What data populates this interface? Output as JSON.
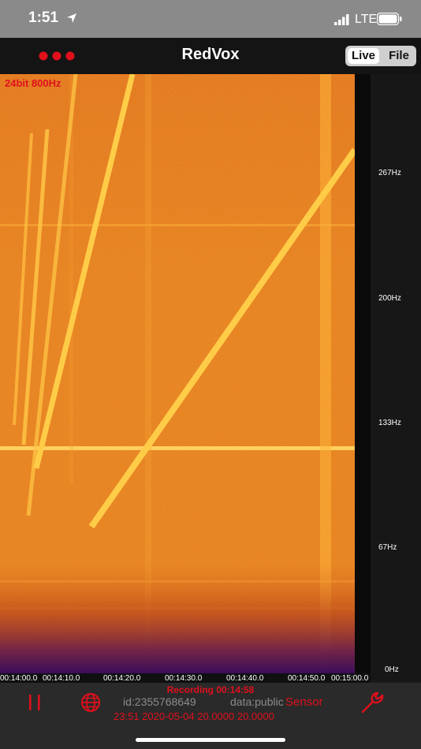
{
  "status_bar": {
    "time": "1:51",
    "carrier": "LTE",
    "icons": [
      "location-arrow-icon",
      "signal-bars-icon",
      "battery-icon"
    ]
  },
  "header": {
    "title": "RedVox",
    "menu_icon": "three-dots-icon",
    "segments": [
      "Live",
      "File"
    ],
    "selected_segment": "Live"
  },
  "spectrogram": {
    "label": "24bit 800Hz",
    "y_ticks": [
      "267Hz",
      "200Hz",
      "133Hz",
      "67Hz",
      "0Hz"
    ],
    "x_ticks": [
      "00:14:00.0",
      "00:14:10.0",
      "00:14:20.0",
      "00:14:30.0",
      "00:14:40.0",
      "00:14:50.0",
      "00:15:00.0"
    ]
  },
  "bottom_bar": {
    "recording": "Recording 00:14:58",
    "station_id": "id:2355768649",
    "data_mode": "data:public",
    "sensor_label": "Sensor",
    "timestamp_line": "23:51 2020-05-04 20.0000 20.0000",
    "icons": [
      "pause-icon",
      "globe-icon",
      "wrench-icon"
    ]
  },
  "colors": {
    "accent_red": "#e0101c",
    "spectrogram_base": "#e8831e",
    "spectrogram_line": "#ffc238"
  }
}
